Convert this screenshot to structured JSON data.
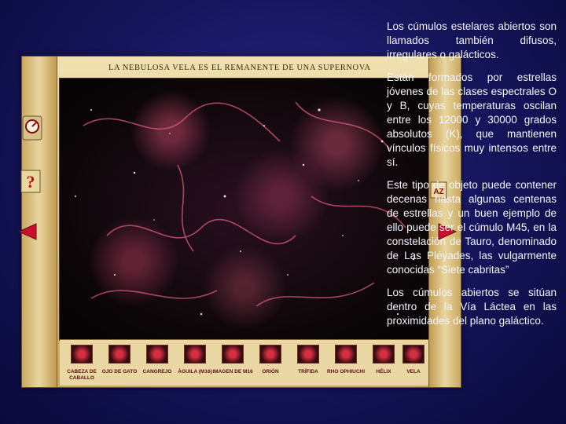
{
  "viewer": {
    "title": "LA NEBULOSA VELA ES EL REMANENTE DE UNA SUPERNOVA",
    "thumbnails": [
      {
        "label": "CABEZA DE CABALLO"
      },
      {
        "label": "OJO DE GATO"
      },
      {
        "label": "CANGREJO"
      },
      {
        "label": "ÁGUILA (M16)"
      },
      {
        "label": "IMAGEN DE M16"
      },
      {
        "label": "ORIÓN"
      },
      {
        "label": "TRÍFIDA"
      },
      {
        "label": "RHO OPHIUCHI"
      },
      {
        "label": "HÉLIX"
      },
      {
        "label": "VELA"
      }
    ]
  },
  "text": {
    "paragraphs": [
      "Los cúmulos estelares abiertos son llamados también difusos, irregulares o galácticos.",
      "Están formados por estrellas jóvenes de las clases espectrales O y B, cuyas temperaturas oscilan entre los 12000 y 30000 grados absolutos (K), que mantienen vínculos físicos muy intensos entre sí.",
      "Este tipo de objeto puede contener decenas hasta algunas centenas de estrellas y un buen ejemplo de ello puede ser el cúmulo M45, en la constelación de Tauro, denominado de Las Pléyades, las vulgarmente conocidas “Siete cabritas”",
      "Los cúmulos abiertos se sitúan dentro de la Vía Láctea en las proximidades del plano galáctico."
    ]
  },
  "icons": {
    "gauge": "gauge-icon",
    "help": "help-icon",
    "left_arrow": "arrow-left-icon",
    "right_arrow": "arrow-right-icon",
    "sort": "sort-az-icon"
  },
  "colors": {
    "background": "#14145a",
    "frame": "#e2cc92",
    "arrow": "#c8102e"
  }
}
